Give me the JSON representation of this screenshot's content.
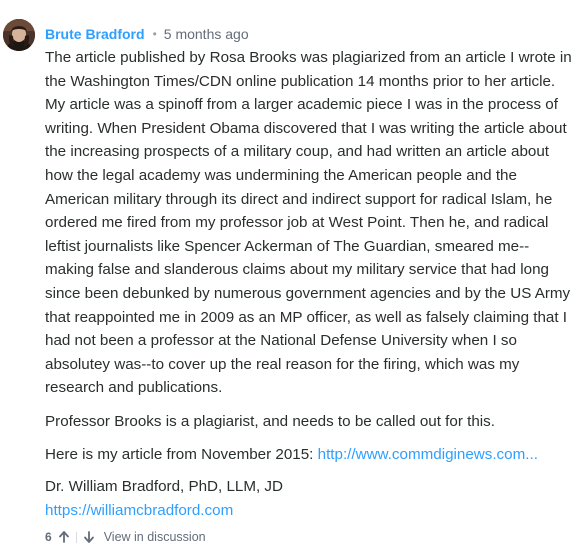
{
  "comment": {
    "author": "Brute Bradford",
    "separator": "•",
    "timestamp": "5 months ago",
    "paragraphs": [
      "The article published by Rosa Brooks was plagiarized from an article I wrote in the Washington Times/CDN online publication 14 months prior to her article. My article was a spinoff from a larger academic piece I was in the process of writing. When President Obama discovered that I was writing the article about the increasing prospects of a military coup, and had written an article about how the legal academy was undermining the American people and the American military through its direct and indirect support for radical Islam, he ordered me fired from my professor job at West Point. Then he, and radical leftist journalists like Spencer Ackerman of The Guardian, smeared me--making false and slanderous claims about my military service that had long since been debunked by numerous government agencies and by the US Army that reappointed me in 2009 as an MP officer, as well as falsely claiming that I had not been a professor at the National Defense University when I so absolutey was--to cover up the real reason for the firing, which was my research and publications.",
      "Professor Brooks is a plagiarist, and needs to be called out for this."
    ],
    "article_intro": "Here is my article from November 2015: ",
    "article_link": "http://www.commdiginews.com...",
    "signature": "Dr. William Bradford, PhD, LLM, JD",
    "website_link": "https://williamcbradford.com",
    "vote_count": "6",
    "view_in_discussion": "View in discussion"
  },
  "colors": {
    "link": "#2e9fff",
    "text": "#2a2e2e",
    "meta": "#656c7a"
  },
  "icons": {
    "upvote": "arrow-up-icon",
    "downvote": "arrow-down-icon"
  }
}
